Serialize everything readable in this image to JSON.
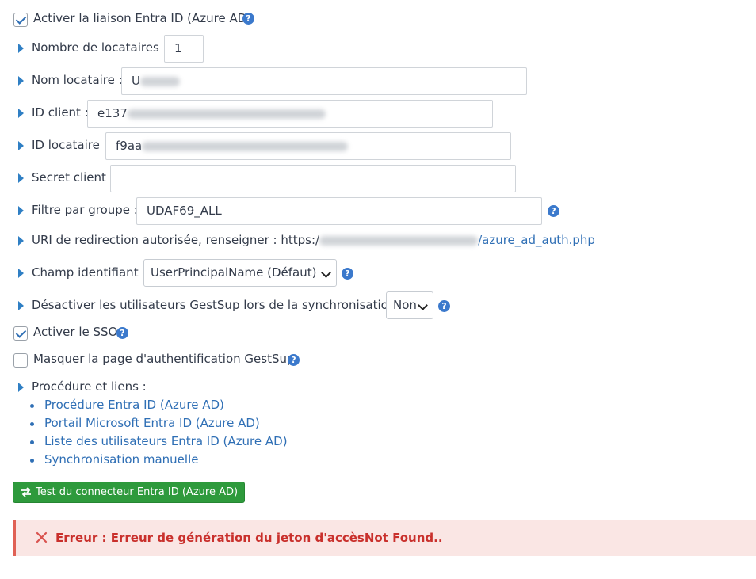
{
  "settings": {
    "enable_link": {
      "label": "Activer la liaison Entra ID (Azure AD)",
      "checked": true
    },
    "tenant_count": {
      "label": "Nombre de locataires :",
      "value": "1"
    },
    "tenant_name": {
      "label": "Nom locataire :",
      "value_visible": "U"
    },
    "client_id": {
      "label": "ID client :",
      "value_visible": "e137"
    },
    "tenant_id": {
      "label": "ID locataire :",
      "value_visible": "f9aa"
    },
    "client_secret": {
      "label": "Secret client :",
      "value": ""
    },
    "group_filter": {
      "label": "Filtre par groupe :",
      "value": "UDAF69_ALL"
    },
    "redirect_uri": {
      "label": "URI de redirection autorisée, renseigner : https:/",
      "suffix": "/azure_ad_auth.php"
    },
    "identifier_field": {
      "label": "Champ identifiant :",
      "selected": "UserPrincipalName (Défaut)"
    },
    "disable_users": {
      "label": "Désactiver les utilisateurs GestSup lors de la synchronisation :",
      "selected": "Non"
    },
    "enable_sso": {
      "label": "Activer le SSO",
      "checked": true
    },
    "hide_auth_page": {
      "label": "Masquer la page d'authentification GestSup",
      "checked": false
    }
  },
  "procedures": {
    "label": "Procédure et liens :",
    "links": [
      "Procédure Entra ID (Azure AD)",
      "Portail Microsoft Entra ID (Azure AD)",
      "Liste des utilisateurs Entra ID (Azure AD)",
      "Synchronisation manuelle"
    ]
  },
  "test_button": {
    "label": "Test du connecteur Entra ID (Azure AD)"
  },
  "error": {
    "text": "Erreur : Erreur de génération du jeton d'accèsNot Found.."
  },
  "help_icon_text": "?",
  "colors": {
    "accent": "#2f6fb5",
    "help": "#3b79cc",
    "button": "#2e9a3c",
    "error_text": "#c9302c",
    "error_bg": "#fae6e4",
    "error_border": "#e06155"
  }
}
